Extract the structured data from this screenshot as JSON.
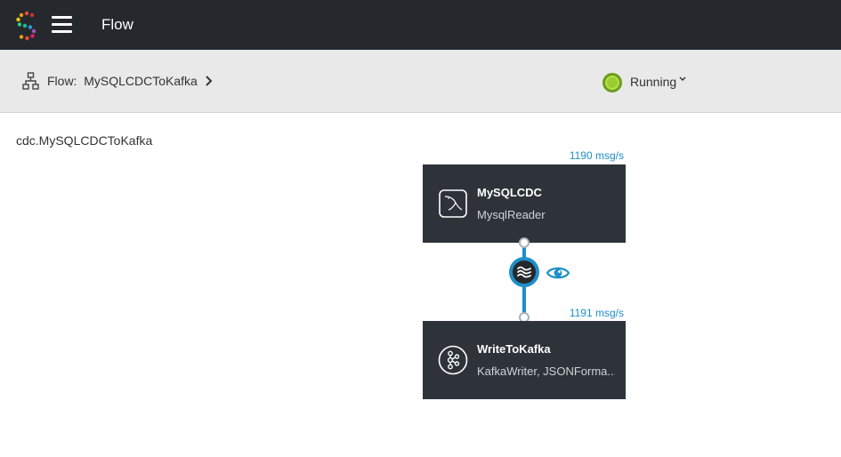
{
  "header": {
    "title": "Flow",
    "logo_icon": "striim-logo-icon",
    "menu_icon": "hamburger-icon"
  },
  "subbar": {
    "breadcrumb": "Flow:  MySQLCDCToKafka",
    "status_label": "Running",
    "status_color": "#9acd32"
  },
  "canvas": {
    "app_name": "cdc.MySQLCDCToKafka",
    "accent_color": "#1e8fc7",
    "nodes": [
      {
        "name": "MySQLCDC",
        "type": "MysqlReader",
        "rate": "1190 msg/s",
        "icon": "mysql-icon"
      },
      {
        "name": "WriteToKafka",
        "type": "KafkaWriter, JSONForma...",
        "rate": "1191 msg/s",
        "icon": "kafka-icon"
      }
    ],
    "stream_icon": "stream-waves-icon",
    "preview_icon": "eye-icon"
  }
}
